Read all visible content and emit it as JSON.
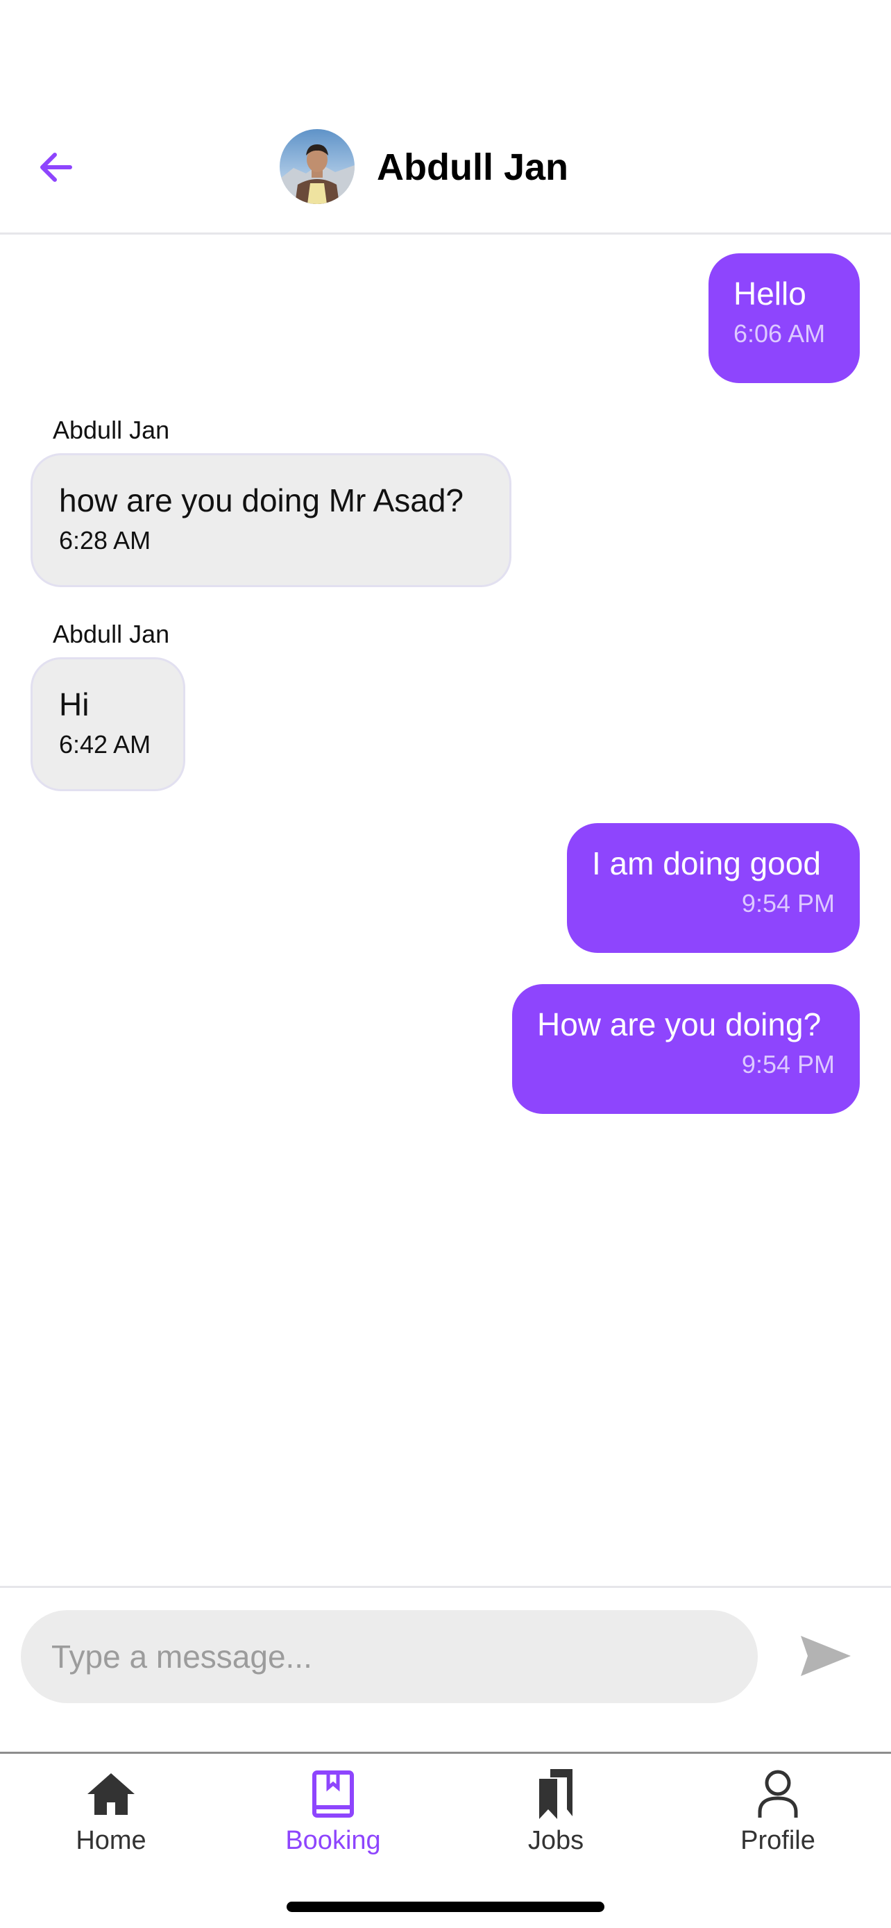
{
  "colors": {
    "accent": "#8e45fd",
    "incoming_bubble": "#ededed",
    "text": "#000000",
    "muted": "#9c9c9c"
  },
  "header": {
    "back_icon": "arrow-left-icon",
    "contact_name": "Abdull Jan"
  },
  "messages": [
    {
      "direction": "outgoing",
      "text": "Hello",
      "time": "6:06 AM"
    },
    {
      "direction": "incoming",
      "sender": "Abdull Jan",
      "text": "how are you doing Mr Asad?",
      "time": "6:28 AM"
    },
    {
      "direction": "incoming",
      "sender": "Abdull Jan",
      "text": "Hi",
      "time": "6:42 AM"
    },
    {
      "direction": "outgoing",
      "text": "I am doing good",
      "time": "9:54 PM"
    },
    {
      "direction": "outgoing",
      "text": "How are you doing?",
      "time": "9:54 PM"
    }
  ],
  "composer": {
    "placeholder": "Type a message...",
    "value": "",
    "send_icon": "send-icon"
  },
  "tabbar": {
    "active": "Booking",
    "tabs": [
      {
        "label": "Home",
        "icon": "home-icon"
      },
      {
        "label": "Booking",
        "icon": "book-icon"
      },
      {
        "label": "Jobs",
        "icon": "bookmarks-icon"
      },
      {
        "label": "Profile",
        "icon": "person-icon"
      }
    ]
  }
}
